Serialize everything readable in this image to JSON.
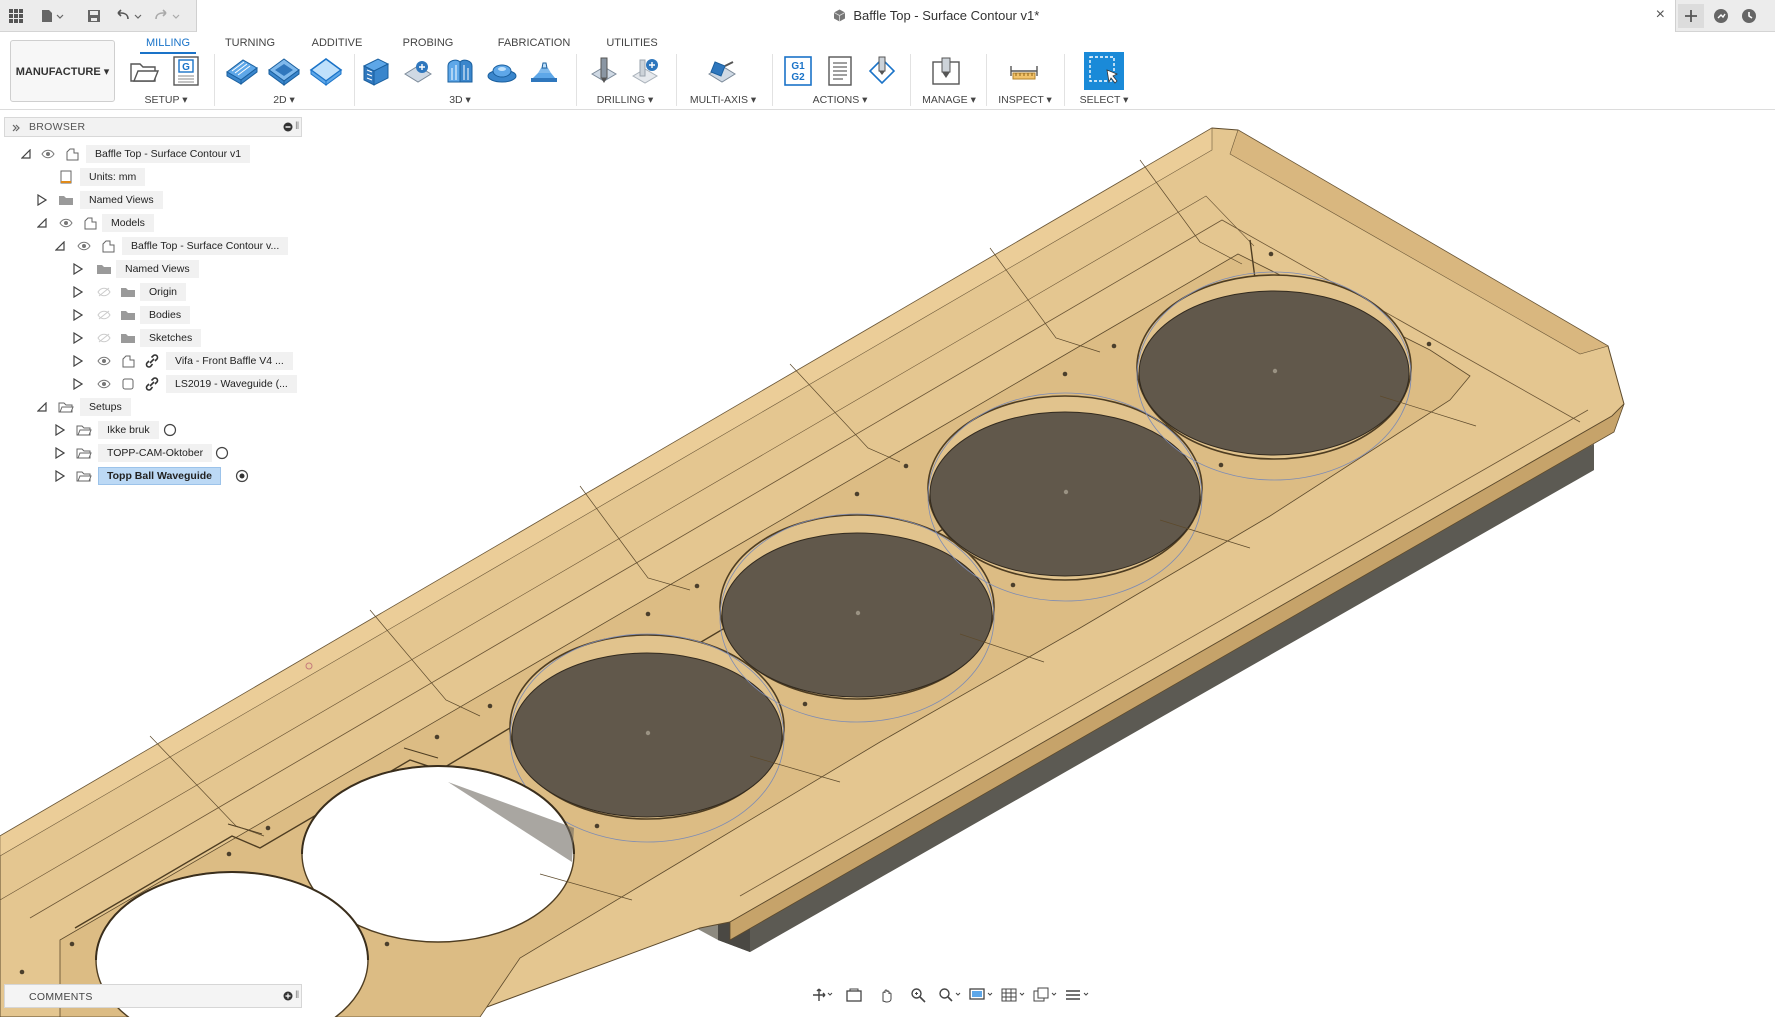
{
  "titlebar": {
    "document_title": "Baffle Top - Surface Contour v1*",
    "quick_access": [
      "grid-icon",
      "file-icon",
      "save-icon",
      "undo-icon",
      "redo-icon"
    ]
  },
  "toolbar": {
    "workspace": "MANUFACTURE ▾",
    "tabs": [
      "MILLING",
      "TURNING",
      "ADDITIVE",
      "PROBING",
      "FABRICATION",
      "UTILITIES"
    ],
    "active_tab": "MILLING",
    "groups": [
      "SETUP ▾",
      "2D ▾",
      "3D ▾",
      "DRILLING ▾",
      "MULTI-AXIS ▾",
      "ACTIONS ▾",
      "MANAGE ▾",
      "INSPECT ▾",
      "SELECT ▾"
    ],
    "actions_gcode": [
      "G1",
      "G2"
    ]
  },
  "browser": {
    "header": "BROWSER",
    "items": [
      {
        "label": "Baffle Top - Surface Contour v1"
      },
      {
        "label": "Units: mm"
      },
      {
        "label": "Named Views"
      },
      {
        "label": "Models"
      },
      {
        "label": "Baffle Top - Surface Contour v..."
      },
      {
        "label": "Named Views"
      },
      {
        "label": "Origin"
      },
      {
        "label": "Bodies"
      },
      {
        "label": "Sketches"
      },
      {
        "label": "Vifa - Front Baffle V4 ..."
      },
      {
        "label": "LS2019 - Waveguide (..."
      },
      {
        "label": "Setups"
      },
      {
        "label": "Ikke bruk"
      },
      {
        "label": "TOPP-CAM-Oktober"
      },
      {
        "label": "Topp Ball Waveguide"
      }
    ]
  },
  "comments": {
    "label": "COMMENTS"
  },
  "colors": {
    "accent": "#1a73c8",
    "model_wood": "#e2c28e",
    "model_shade": "#c9a56c",
    "model_pocket": "#5f574b",
    "base_plate": "#6c6a62"
  }
}
